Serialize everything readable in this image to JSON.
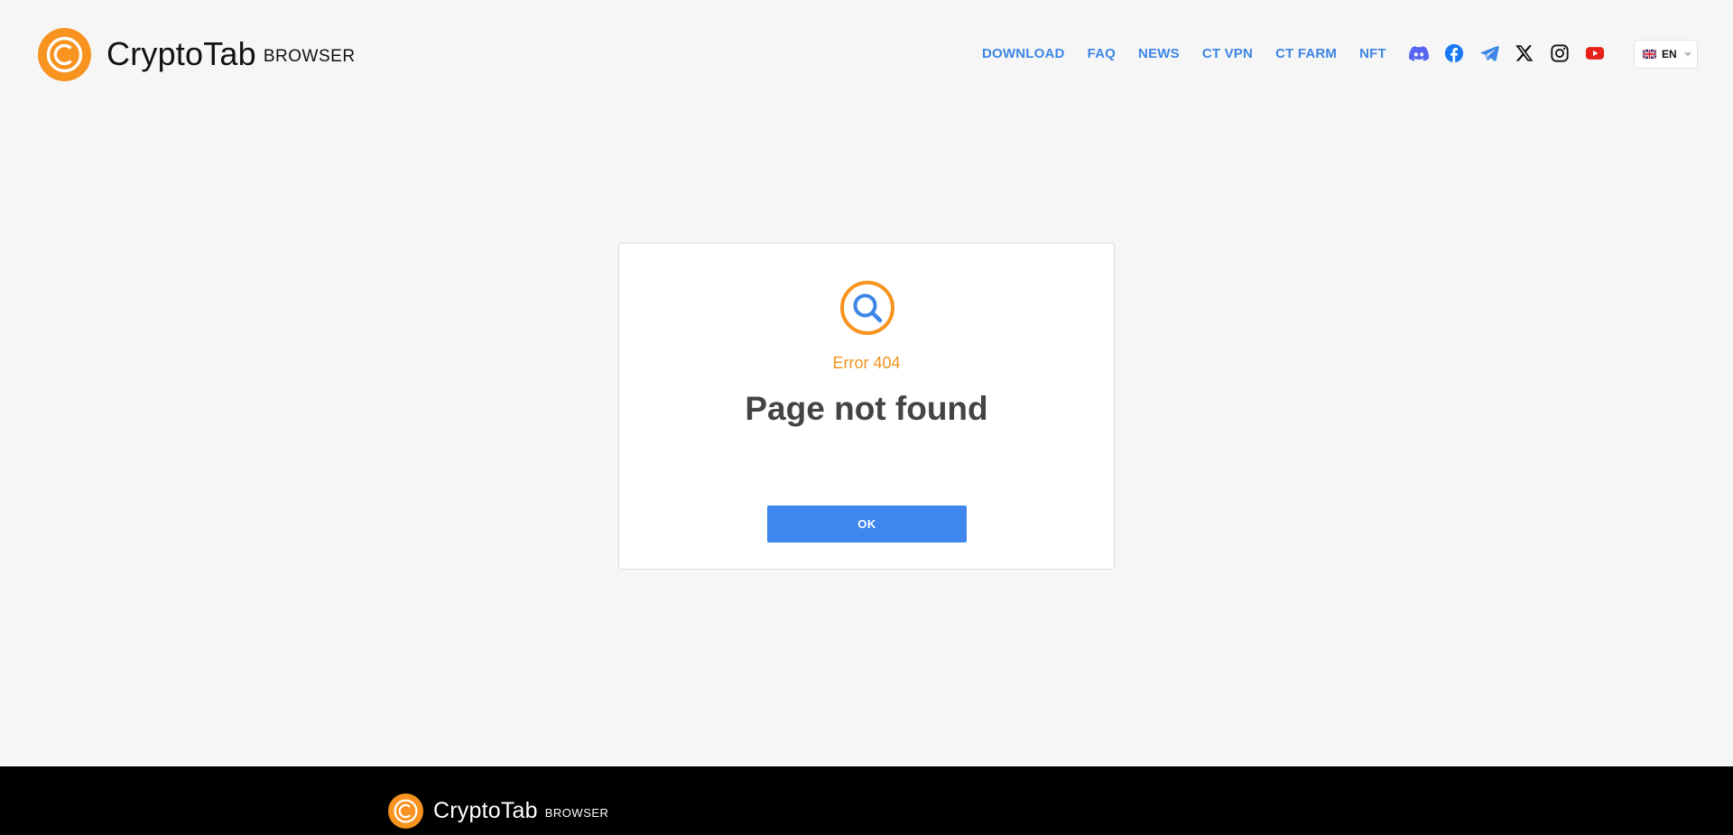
{
  "brand": {
    "name": "CryptoTab",
    "sub": "BROWSER"
  },
  "nav": {
    "items": [
      "DOWNLOAD",
      "FAQ",
      "NEWS",
      "CT VPN",
      "CT FARM",
      "NFT"
    ]
  },
  "social": [
    "discord-icon",
    "facebook-icon",
    "telegram-icon",
    "x-icon",
    "instagram-icon",
    "youtube-icon"
  ],
  "language": {
    "code": "EN"
  },
  "error": {
    "code_text": "Error 404",
    "title": "Page not found",
    "button_label": "OK"
  },
  "colors": {
    "accent_orange": "#f7931e",
    "link_blue": "#3d86e6",
    "button_blue": "#3f86ee",
    "footer_bg": "#000000"
  }
}
